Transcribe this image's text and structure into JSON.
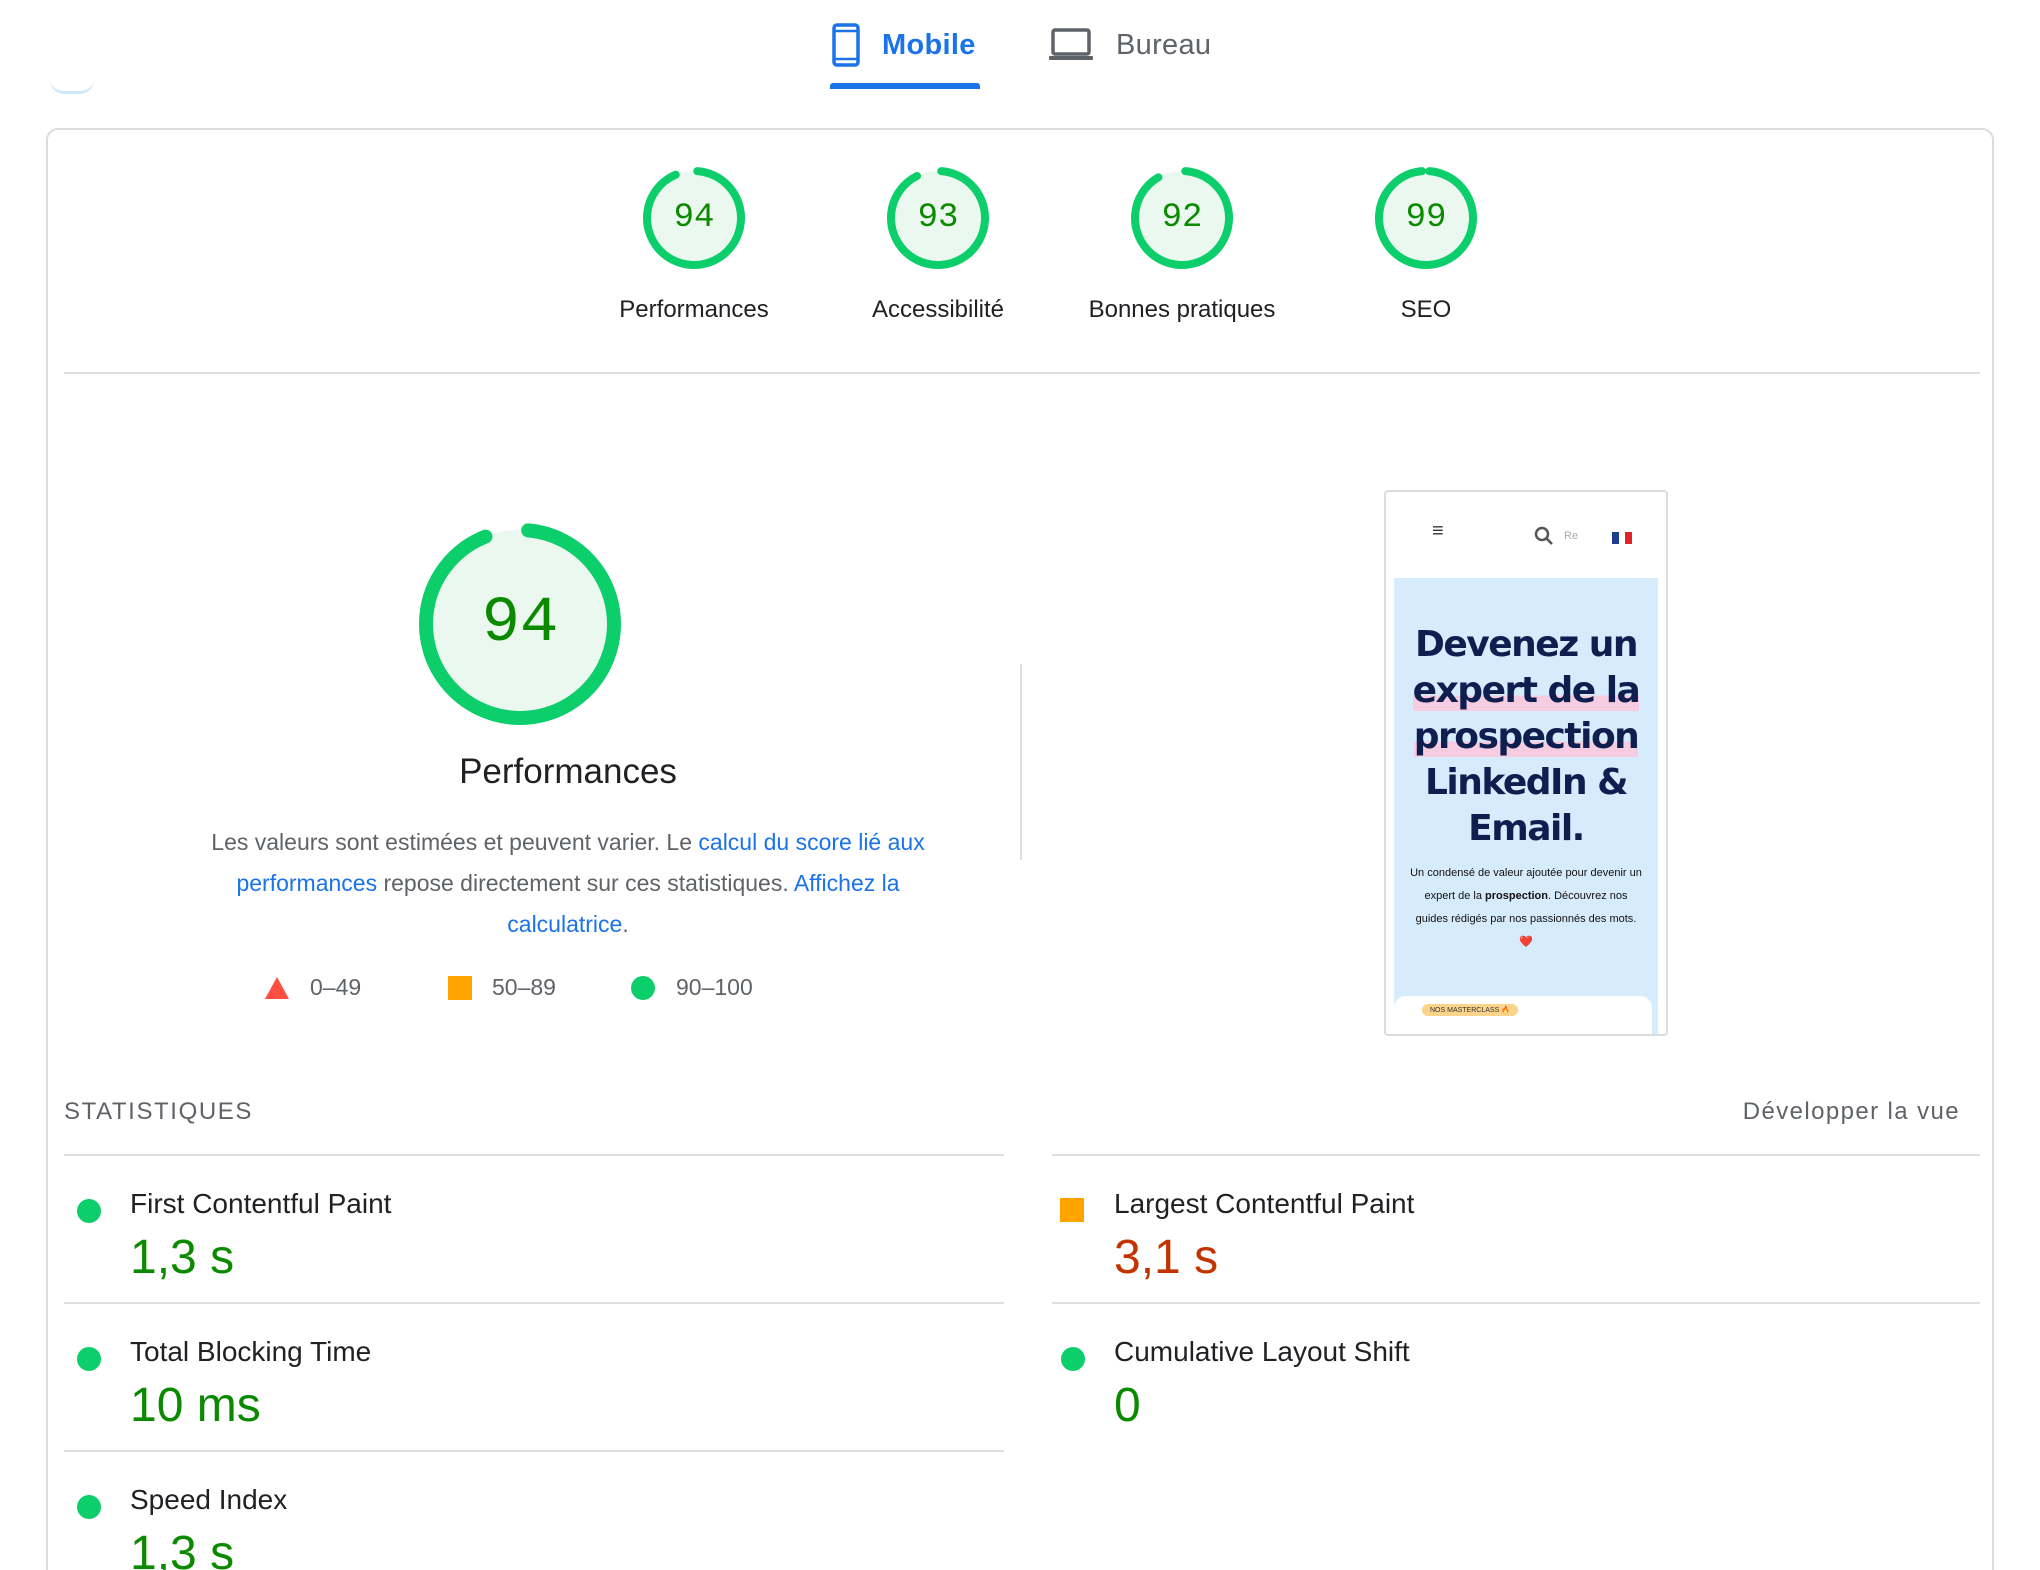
{
  "tabs": {
    "mobile_label": "Mobile",
    "desktop_label": "Bureau",
    "active": "Mobile"
  },
  "colors": {
    "accent": "#1a73e8",
    "pass": "#0cce6b",
    "average": "#ffa400",
    "fail": "#ff4e42",
    "pass_text": "#0b8a00",
    "average_text": "#c33300"
  },
  "scores": [
    {
      "label": "Performances",
      "value": "94"
    },
    {
      "label": "Accessibilité",
      "value": "93"
    },
    {
      "label": "Bonnes pratiques",
      "value": "92"
    },
    {
      "label": "SEO",
      "value": "99"
    }
  ],
  "performance": {
    "score": "94",
    "title": "Performances",
    "desc_1": "Les valeurs sont estimées et peuvent varier. Le ",
    "link_1": "calcul du score lié aux performances",
    "desc_2": " repose directement sur ces statistiques. ",
    "link_2": "Affichez la calculatrice",
    "desc_3": "."
  },
  "legend": [
    {
      "icon": "triangle-icon",
      "range": "0–49"
    },
    {
      "icon": "square-icon",
      "range": "50–89"
    },
    {
      "icon": "circle-icon",
      "range": "90–100"
    }
  ],
  "screenshot": {
    "search_text": "Re",
    "headline_1": "Devenez un",
    "headline_2": "expert de la",
    "headline_3": "prospection",
    "headline_4": "LinkedIn &",
    "headline_5": "Email.",
    "body_1": "Un condensé de valeur ajoutée pour devenir un expert de la ",
    "body_bold": "prospection",
    "body_2": ". Découvrez nos guides rédigés par nos passionnés des mots. ❤️",
    "pill": "NOS MASTERCLASS 🔥"
  },
  "stats": {
    "title": "STATISTIQUES",
    "expand_label": "Développer la vue",
    "metrics": [
      {
        "name": "First Contentful Paint",
        "value": "1,3 s",
        "status": "pass"
      },
      {
        "name": "Largest Contentful Paint",
        "value": "3,1 s",
        "status": "average"
      },
      {
        "name": "Total Blocking Time",
        "value": "10 ms",
        "status": "pass"
      },
      {
        "name": "Cumulative Layout Shift",
        "value": "0",
        "status": "pass"
      },
      {
        "name": "Speed Index",
        "value": "1,3 s",
        "status": "pass"
      }
    ]
  }
}
